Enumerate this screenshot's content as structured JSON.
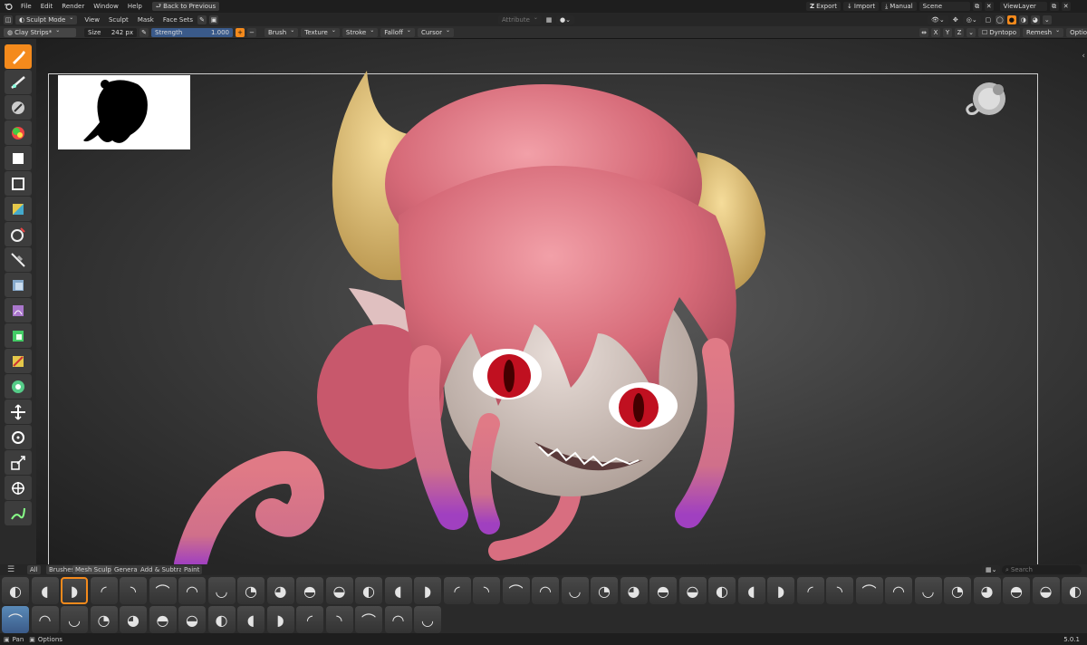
{
  "menu": {
    "items": [
      "File",
      "Edit",
      "Render",
      "Window",
      "Help"
    ],
    "back_label": "Back to Previous"
  },
  "header": {
    "mode_label": "Sculpt Mode",
    "items": [
      "View",
      "Sculpt",
      "Mask",
      "Face Sets"
    ],
    "attribute_label": "Attribute",
    "export_label": "Export",
    "import_label": "Import",
    "manual_label": "Manual",
    "scene_label": "Scene",
    "viewlayer_label": "ViewLayer"
  },
  "tool_settings": {
    "brush_name": "Clay Strips*",
    "size_label": "Size",
    "size_value": "242 px",
    "strength_label": "Strength",
    "strength_value": "1.000",
    "plus_label": "+",
    "minus_label": "−",
    "menus": [
      "Brush",
      "Texture",
      "Stroke",
      "Falloff",
      "Cursor"
    ],
    "axes": [
      "X",
      "Y",
      "Z"
    ],
    "dyntopo_label": "Dyntopo",
    "remesh_label": "Remesh",
    "options_label": "Options"
  },
  "toolbar": {
    "tools": [
      "draw-brush-tool",
      "smooth-brush-tool",
      "grab-tool",
      "paint-tool",
      "box-mask-tool",
      "lasso-mask-tool",
      "face-set-tool",
      "trim-tool",
      "line-project-tool",
      "mesh-filter-tool",
      "cloth-filter-tool",
      "color-filter-tool",
      "edit-face-set-tool",
      "mask-by-color-tool",
      "move-tool",
      "rotate-tool",
      "scale-tool",
      "transform-tool",
      "annotate-tool"
    ]
  },
  "shelf": {
    "tabs": [
      "All",
      "Brushes",
      "Mesh Sculpt",
      "General",
      "Add & Subtract",
      "Paint"
    ],
    "search_placeholder": "Search",
    "active_index": 2
  },
  "status": {
    "pan_label": "Pan",
    "options_label": "Options",
    "version": "5.0.1"
  },
  "colors": {
    "accent": "#f48a1c",
    "hair": "#e0707e",
    "horn": "#d9b870",
    "skin": "#d8c8c0",
    "eye": "#c01020"
  }
}
